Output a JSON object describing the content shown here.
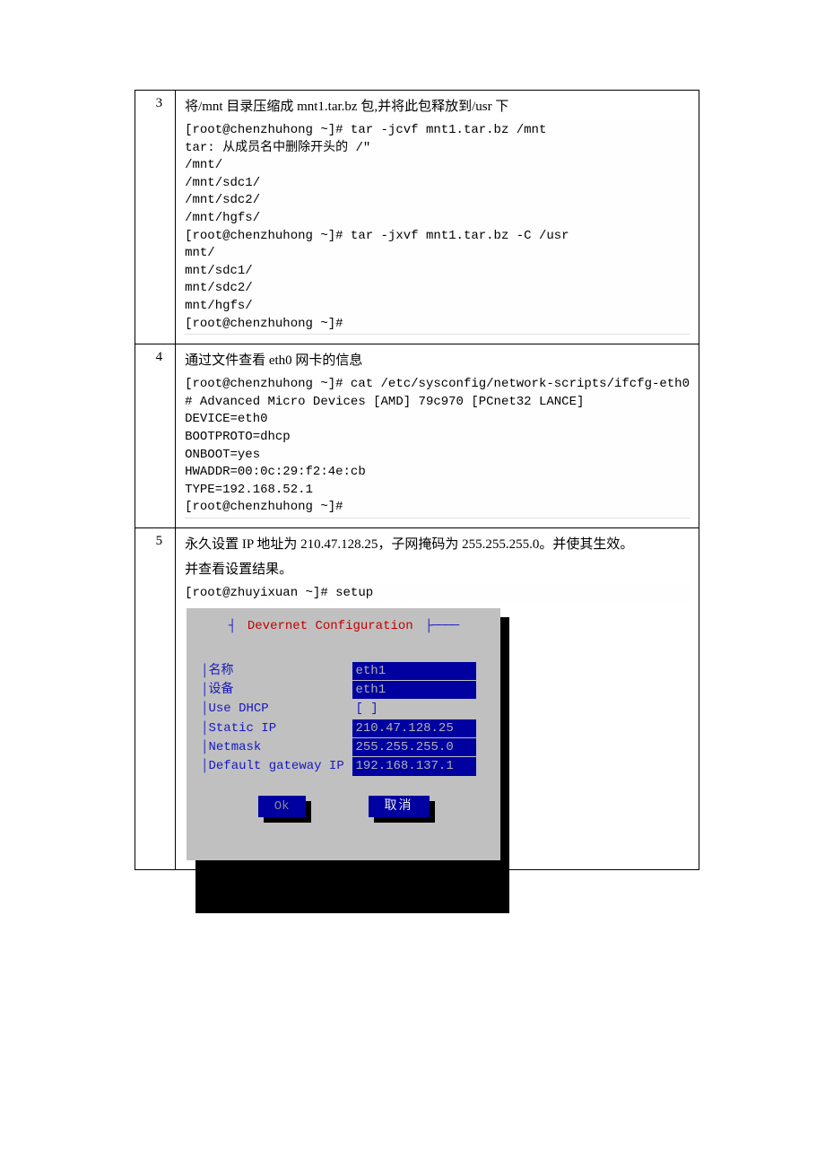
{
  "sections": {
    "s3": {
      "num": "3",
      "title": "将/mnt 目录压缩成 mnt1.tar.bz 包,并将此包释放到/usr 下",
      "term": "[root@chenzhuhong ~]# tar -jcvf mnt1.tar.bz /mnt\ntar: 从成员名中删除开头的 /\"\n/mnt/\n/mnt/sdc1/\n/mnt/sdc2/\n/mnt/hgfs/\n[root@chenzhuhong ~]# tar -jxvf mnt1.tar.bz -C /usr\nmnt/\nmnt/sdc1/\nmnt/sdc2/\nmnt/hgfs/\n[root@chenzhuhong ~]#"
    },
    "s4": {
      "num": "4",
      "title": "通过文件查看 eth0 网卡的信息",
      "term": "[root@chenzhuhong ~]# cat /etc/sysconfig/network-scripts/ifcfg-eth0\n# Advanced Micro Devices [AMD] 79c970 [PCnet32 LANCE]\nDEVICE=eth0\nBOOTPROTO=dhcp\nONBOOT=yes\nHWADDR=00:0c:29:f2:4e:cb\nTYPE=192.168.52.1\n[root@chenzhuhong ~]#"
    },
    "s5": {
      "num": "5",
      "title_line1": "永久设置 IP 地址为 210.47.128.25，子网掩码为 255.255.255.0。并使其生效。",
      "title_line2": "并查看设置结果。",
      "cmd": "[root@zhuyixuan ~]# setup",
      "dialog": {
        "title": "Devernet Configuration",
        "rows": [
          {
            "label": "名称",
            "value": "eth1",
            "field": true
          },
          {
            "label": "设备",
            "value": "eth1",
            "field": true
          },
          {
            "label": "Use DHCP",
            "value": "[ ]",
            "field": false,
            "short": true
          },
          {
            "label": "Static IP",
            "value": "210.47.128.25",
            "field": true
          },
          {
            "label": "Netmask",
            "value": "255.255.255.0",
            "field": true
          },
          {
            "label": "Default gateway IP",
            "value": "192.168.137.1",
            "field": true
          }
        ],
        "ok": "Ok",
        "cancel": "取消"
      }
    }
  }
}
